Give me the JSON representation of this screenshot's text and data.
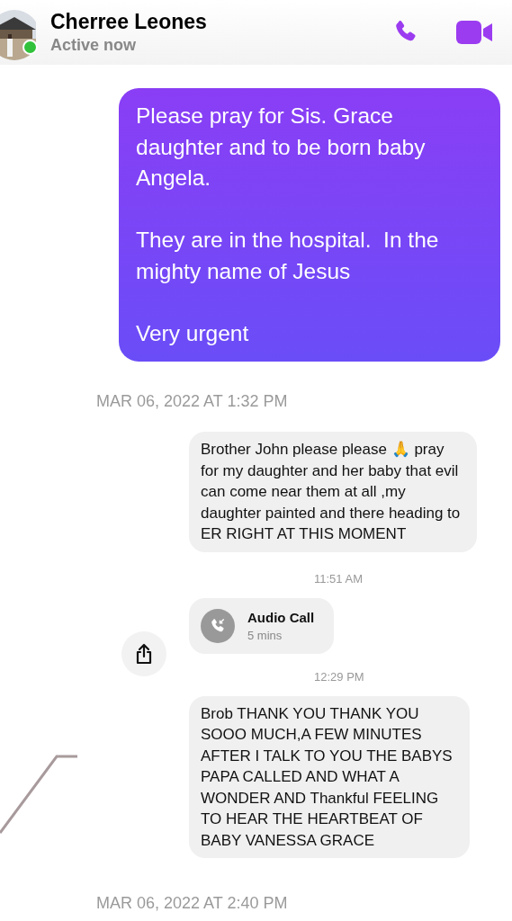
{
  "header": {
    "name": "Cherree Leones",
    "status": "Active now",
    "online": true
  },
  "messages": [
    {
      "kind": "sent",
      "text": "Please pray for Sis. Grace daughter and to be born baby Angela.\n\nThey are in the hospital.  In the mighty name of Jesus\n\nVery urgent"
    },
    {
      "kind": "date",
      "text": "MAR 06, 2022 AT 1:32 PM"
    },
    {
      "kind": "received",
      "text": "Brother John please please 🙏 pray for my daughter and her baby that evil can come near them at all ,my daughter painted and there heading to ER RIGHT AT THIS MOMENT"
    },
    {
      "kind": "time",
      "text": "11:51 AM"
    },
    {
      "kind": "call",
      "title": "Audio Call",
      "duration": "5 mins"
    },
    {
      "kind": "time",
      "text": "12:29 PM"
    },
    {
      "kind": "received",
      "text": "Brob THANK YOU THANK YOU SOOO MUCH,A FEW MINUTES AFTER I TALK TO YOU THE BABYS PAPA CALLED AND WHAT A WONDER AND Thankful FEELING TO HEAR THE HEARTBEAT OF BABY  VANESSA GRACE"
    },
    {
      "kind": "date",
      "text": "MAR 06, 2022 AT 2:40 PM"
    }
  ]
}
